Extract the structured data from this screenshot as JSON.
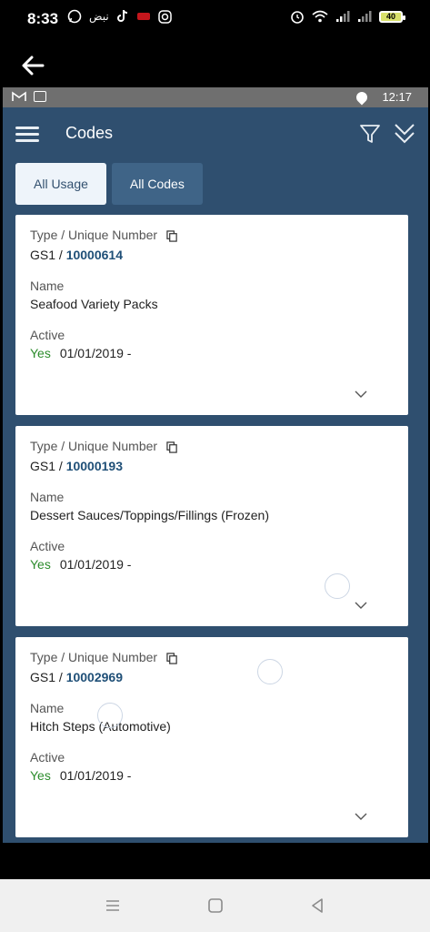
{
  "status_bar": {
    "time": "8:33",
    "left_small_text": "نبض",
    "battery": "40"
  },
  "device_bar": {
    "time": "12:17"
  },
  "app": {
    "title": "Codes",
    "tabs": [
      {
        "label": "All Usage",
        "active": true
      },
      {
        "label": "All Codes",
        "active": false
      }
    ],
    "cards": [
      {
        "type_label": "Type / Unique Number",
        "prefix": "GS1 / ",
        "number": "10000614",
        "name_label": "Name",
        "name": "Seafood Variety Packs",
        "active_label": "Active",
        "active": "Yes",
        "date": "01/01/2019 -"
      },
      {
        "type_label": "Type / Unique Number",
        "prefix": "GS1 / ",
        "number": "10000193",
        "name_label": "Name",
        "name": "Dessert Sauces/Toppings/Fillings (Frozen)",
        "active_label": "Active",
        "active": "Yes",
        "date": "01/01/2019 -"
      },
      {
        "type_label": "Type / Unique Number",
        "prefix": "GS1 / ",
        "number": "10002969",
        "name_label": "Name",
        "name": "Hitch Steps (Automotive)",
        "active_label": "Active",
        "active": "Yes",
        "date": "01/01/2019 -"
      }
    ]
  },
  "icons": [
    "back-arrow-icon",
    "menu-icon",
    "filter-icon",
    "chevrons-down-icon",
    "copy-icon",
    "chevron-down-icon"
  ],
  "colors": {
    "app_bg": "#2f4f6f",
    "accent": "#1f4f77",
    "yes": "#2c8c2c"
  }
}
